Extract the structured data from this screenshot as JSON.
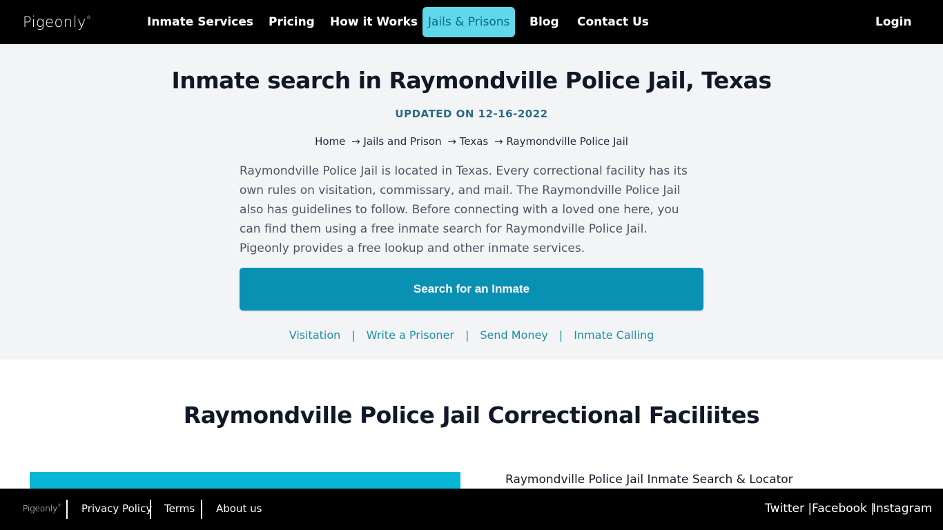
{
  "brand": {
    "name": "Pigeonly",
    "mark": "®"
  },
  "nav": {
    "items": [
      {
        "label": "Inmate Services"
      },
      {
        "label": "Pricing"
      },
      {
        "label": "How it Works"
      },
      {
        "label": "Jails & Prisons",
        "active": true
      },
      {
        "label": "Blog"
      },
      {
        "label": "Contact Us"
      }
    ],
    "login": "Login"
  },
  "hero": {
    "title": "Inmate search in Raymondville Police Jail, Texas",
    "updated": "UPDATED ON 12-16-2022",
    "breadcrumb": [
      "Home",
      "→ Jails and Prison",
      "→ Texas",
      "→ Raymondville Police Jail"
    ],
    "description": "Raymondville Police Jail is located in Texas. Every correctional facility has its own rules on visitation, commissary, and mail. The Raymondville Police Jail also has guidelines to follow. Before connecting with a loved one here, you can find them using a free inmate search for Raymondville Police Jail. Pigeonly provides a free lookup and other inmate services.",
    "search_button": "Search for an Inmate",
    "links": [
      "Visitation",
      "Write a Prisoner",
      "Send Money",
      "Inmate Calling"
    ],
    "link_separator": "|"
  },
  "facilities": {
    "title": "Raymondville Police Jail Correctional Faciliites",
    "locator": "Raymondville Police Jail Inmate Search & Locator"
  },
  "footer": {
    "links": [
      "Privacy Policy",
      "Terms",
      "About us"
    ],
    "social": [
      "Twitter |",
      "Facebook |",
      "Instagram"
    ]
  },
  "colors": {
    "nav_bg": "#000000",
    "active_tab": "#5fd8ea",
    "accent": "#0891b2",
    "link": "#1b8fa8",
    "hero_bg": "#f3f4f6"
  }
}
